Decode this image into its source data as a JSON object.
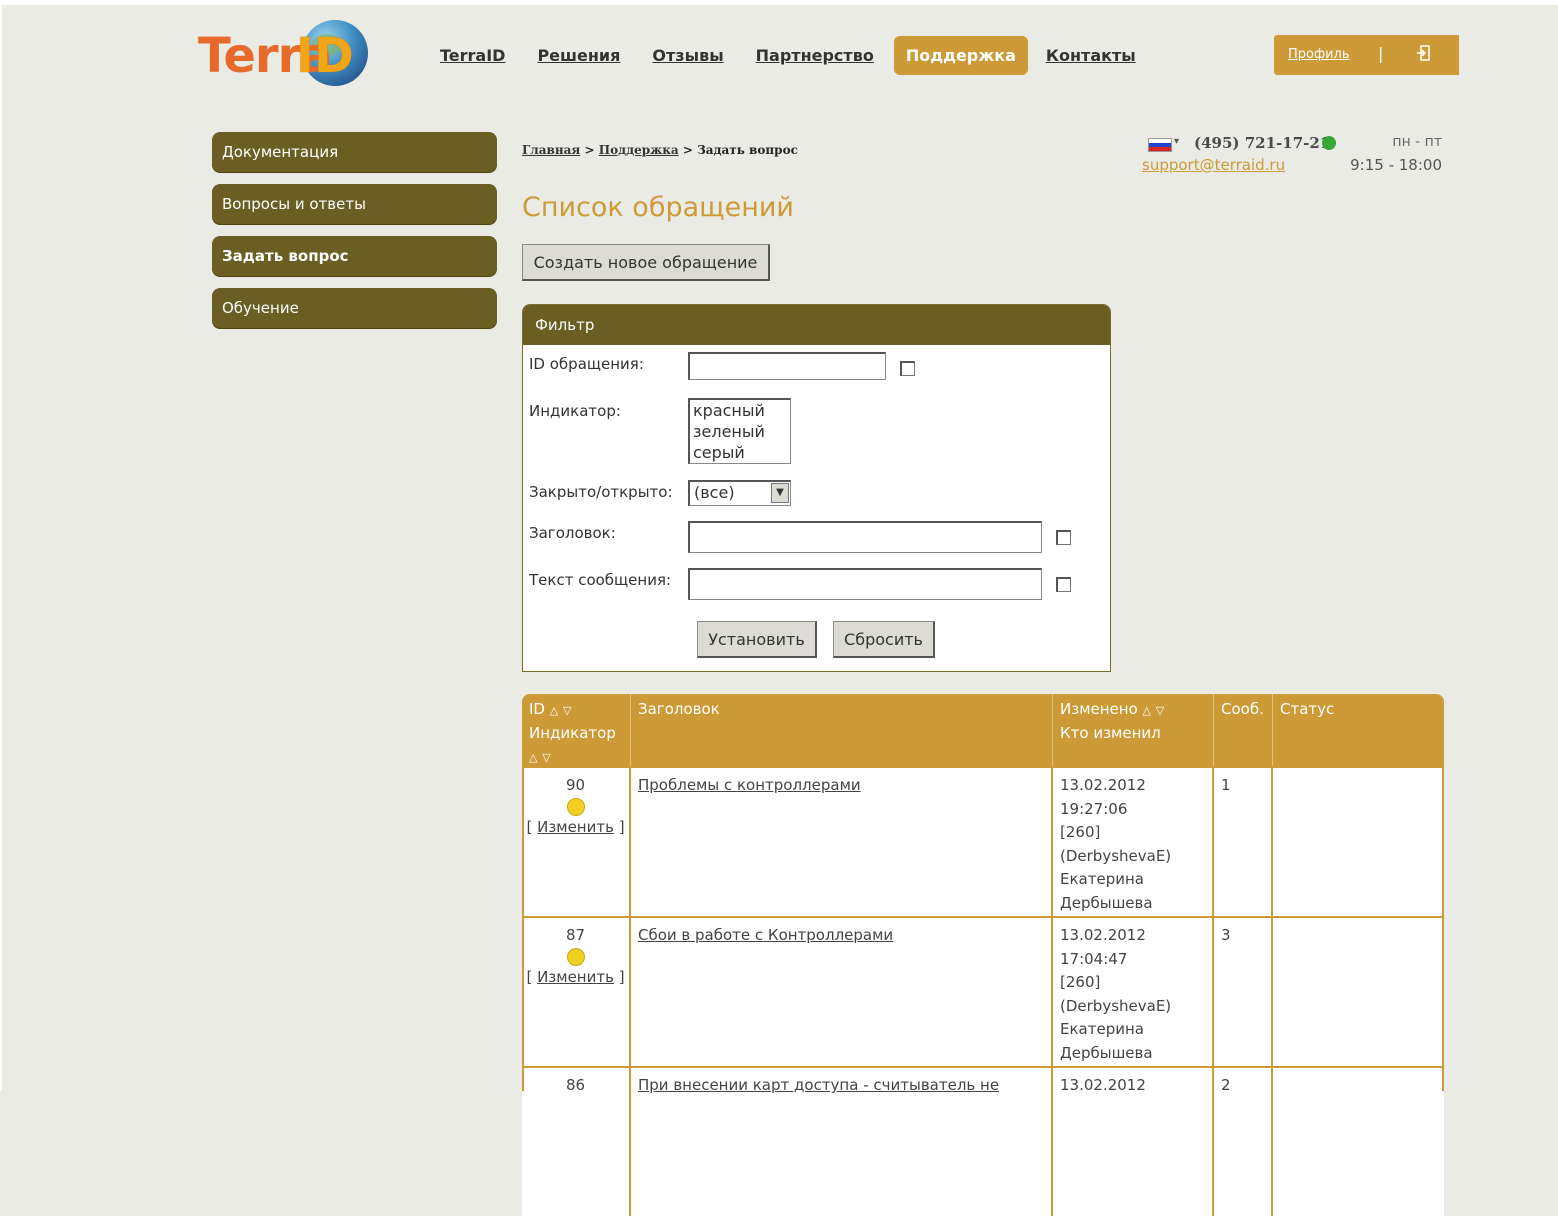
{
  "logo": {
    "part1": "Terra",
    "part2": "ID"
  },
  "nav": {
    "items": [
      "TerraID",
      "Решения",
      "Отзывы",
      "Партнерство",
      "Поддержка",
      "Контакты"
    ]
  },
  "profile": {
    "label": "Профиль",
    "separator": "|",
    "exit_icon": "exit-icon"
  },
  "sidebar": {
    "items": [
      "Документация",
      "Вопросы и ответы",
      "Задать вопрос",
      "Обучение"
    ]
  },
  "breadcrumb": {
    "home": "Главная",
    "support": "Поддержка",
    "current": "Задать вопрос",
    "sep": ">"
  },
  "contact": {
    "phone": "(495) 721-17-21",
    "email": "support@terraid.ru",
    "days": "пн - пт",
    "hours": "9:15 - 18:00"
  },
  "page": {
    "title": "Список обращений",
    "create_button": "Создать новое обращение"
  },
  "filter": {
    "title": "Фильтр",
    "id_label": "ID обращения:",
    "indicator_label": "Индикатор:",
    "indicator_options": [
      "красный",
      "зеленый",
      "серый"
    ],
    "closed_label": "Закрыто/открыто:",
    "closed_value": "(все)",
    "title_label": "Заголовок:",
    "text_label": "Текст сообщения:",
    "set_button": "Установить",
    "reset_button": "Сбросить"
  },
  "table": {
    "headers": {
      "id": "ID",
      "indicator": "Индикатор",
      "title": "Заголовок",
      "changed": "Изменено",
      "changed_by": "Кто изменил",
      "messages": "Сооб.",
      "status": "Статус"
    },
    "edit_label": "Изменить",
    "rows": [
      {
        "id": "90",
        "title": "Проблемы с контроллерами",
        "date": "13.02.2012",
        "time": "19:27:06",
        "user_id": "[260]",
        "login": "(DerbyshevaE)",
        "first": "Екатерина",
        "last": "Дербышева",
        "messages": "1",
        "status": ""
      },
      {
        "id": "87",
        "title": "Сбои в работе с Контроллерами",
        "date": "13.02.2012",
        "time": "17:04:47",
        "user_id": "[260]",
        "login": "(DerbyshevaE)",
        "first": "Екатерина",
        "last": "Дербышева",
        "messages": "3",
        "status": ""
      },
      {
        "id": "86",
        "title": "При внесении карт доступа - считыватель не",
        "date": "13.02.2012",
        "messages": "2",
        "status": ""
      }
    ]
  },
  "colors": {
    "accent": "#cc9a36",
    "sidebar": "#6b5e22",
    "background": "#ebebe6"
  }
}
